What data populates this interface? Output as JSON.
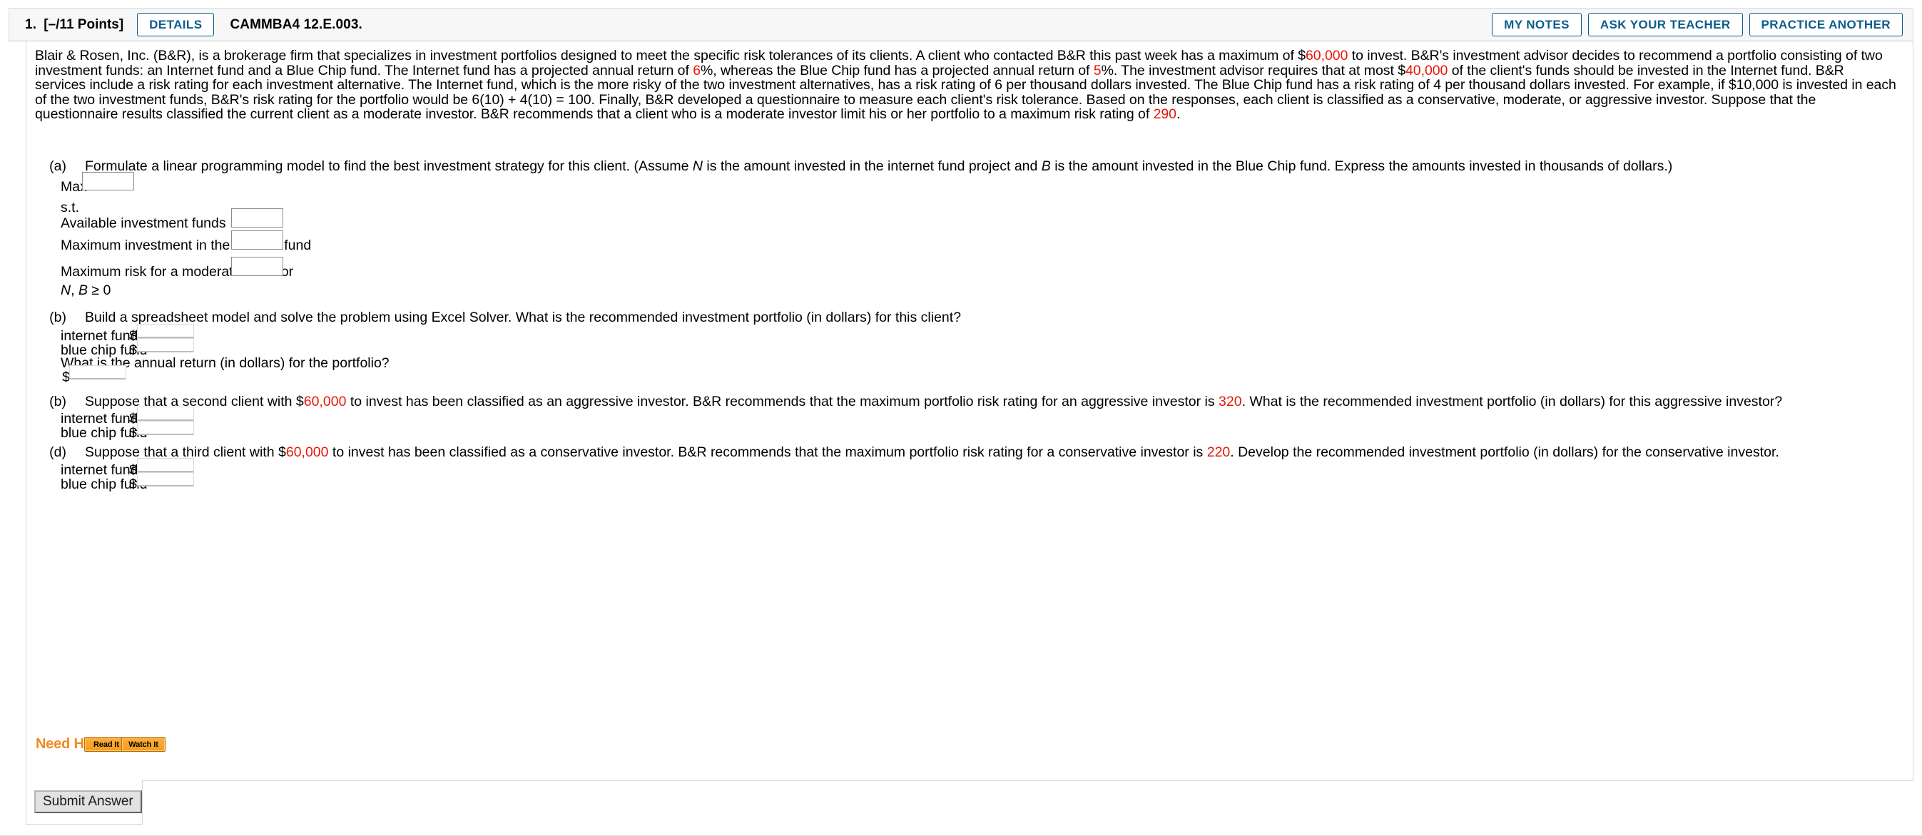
{
  "header": {
    "question_number": "1.",
    "points": "[–/11 Points]",
    "details_label": "DETAILS",
    "question_code": "CAMMBA4 12.E.003.",
    "my_notes_label": "MY NOTES",
    "ask_teacher_label": "ASK YOUR TEACHER",
    "practice_another_label": "PRACTICE ANOTHER",
    "accent_color": "#0b5d8a"
  },
  "stem": {
    "p1a": "Blair & Rosen, Inc. (B&R), is a brokerage firm that specializes in investment portfolios designed to meet the specific risk tolerances of its clients. A client who contacted B&R this past week has a maximum of $",
    "v1": "60,000",
    "p1b": " to invest. B&R's investment advisor decides to recommend a portfolio consisting of two investment funds: an Internet fund and a Blue Chip fund. The Internet fund has a projected annual return of ",
    "v2": "6",
    "p1c": "%, whereas the Blue Chip fund has a projected annual return of ",
    "v3": "5",
    "p1d": "%. The investment advisor requires that at most $",
    "v4": "40,000",
    "p1e": " of the client's funds should be invested in the Internet fund. B&R services include a risk rating for each investment alternative. The Internet fund, which is the more risky of the two investment alternatives, has a risk rating of 6 per thousand dollars invested. The Blue Chip fund has a risk rating of 4 per thousand dollars invested. For example, if $10,000 is invested in each of the two investment funds, B&R's risk rating for the portfolio would be 6(10) + 4(10) = 100. Finally, B&R developed a questionnaire to measure each client's risk tolerance. Based on the responses, each client is classified as a conservative, moderate, or aggressive investor. Suppose that the questionnaire results classified the current client as a moderate investor. B&R recommends that a client who is a moderate investor limit his or her portfolio to a maximum risk rating of ",
    "v5": "290",
    "p1f": "."
  },
  "part_a": {
    "label": "(a)",
    "text_1": "Formulate a linear programming model to find the best investment strategy for this client. (Assume ",
    "var_n": "N",
    "text_2": " is the amount invested in the internet fund project and ",
    "var_b": "B",
    "text_3": " is the amount invested in the Blue Chip fund. Express the amounts invested in thousands of dollars.)",
    "max_label": "Max",
    "max_value": "",
    "st_label": "s.t.",
    "constraints": [
      {
        "label": "Available investment funds",
        "value": ""
      },
      {
        "label": "Maximum investment in the internet fund",
        "value": ""
      },
      {
        "label": "Maximum risk for a moderate investor",
        "value": ""
      }
    ],
    "nonneg_n": "N",
    "nonneg_sep": ", ",
    "nonneg_b": "B",
    "nonneg_tail": " ≥ 0"
  },
  "part_b1": {
    "label": "(b)",
    "text": "Build a spreadsheet model and solve the problem using Excel Solver. What is the recommended investment portfolio (in dollars) for this client?",
    "rows": [
      {
        "label": "internet fund",
        "currency": "$",
        "value": ""
      },
      {
        "label": "blue chip fund",
        "currency": "$",
        "value": ""
      }
    ],
    "followup": "What is the annual return (in dollars) for the portfolio?",
    "followup_currency": "$",
    "followup_value": ""
  },
  "part_b2": {
    "label": "(b)",
    "text_1": "Suppose that a second client with $",
    "v_amount": "60,000",
    "text_2": " to invest has been classified as an aggressive investor. B&R recommends that the maximum portfolio risk rating for an aggressive investor is ",
    "v_risk": "320",
    "text_3": ". What is the recommended investment portfolio (in dollars) for this aggressive investor?",
    "rows": [
      {
        "label": "internet fund",
        "currency": "$",
        "value": ""
      },
      {
        "label": "blue chip fund",
        "currency": "$",
        "value": ""
      }
    ]
  },
  "part_d": {
    "label": "(d)",
    "text_1": "Suppose that a third client with $",
    "v_amount": "60,000",
    "text_2": " to invest has been classified as a conservative investor. B&R recommends that the maximum portfolio risk rating for a conservative investor is ",
    "v_risk": "220",
    "text_3": ". Develop the recommended investment portfolio (in dollars) for the conservative investor.",
    "rows": [
      {
        "label": "internet fund",
        "currency": "$",
        "value": ""
      },
      {
        "label": "blue chip fund",
        "currency": "$",
        "value": ""
      }
    ]
  },
  "help": {
    "label": "Need Help?",
    "read_it": "Read It",
    "watch_it": "Watch It",
    "color": "#f08b1d"
  },
  "footer": {
    "submit_label": "Submit Answer"
  }
}
